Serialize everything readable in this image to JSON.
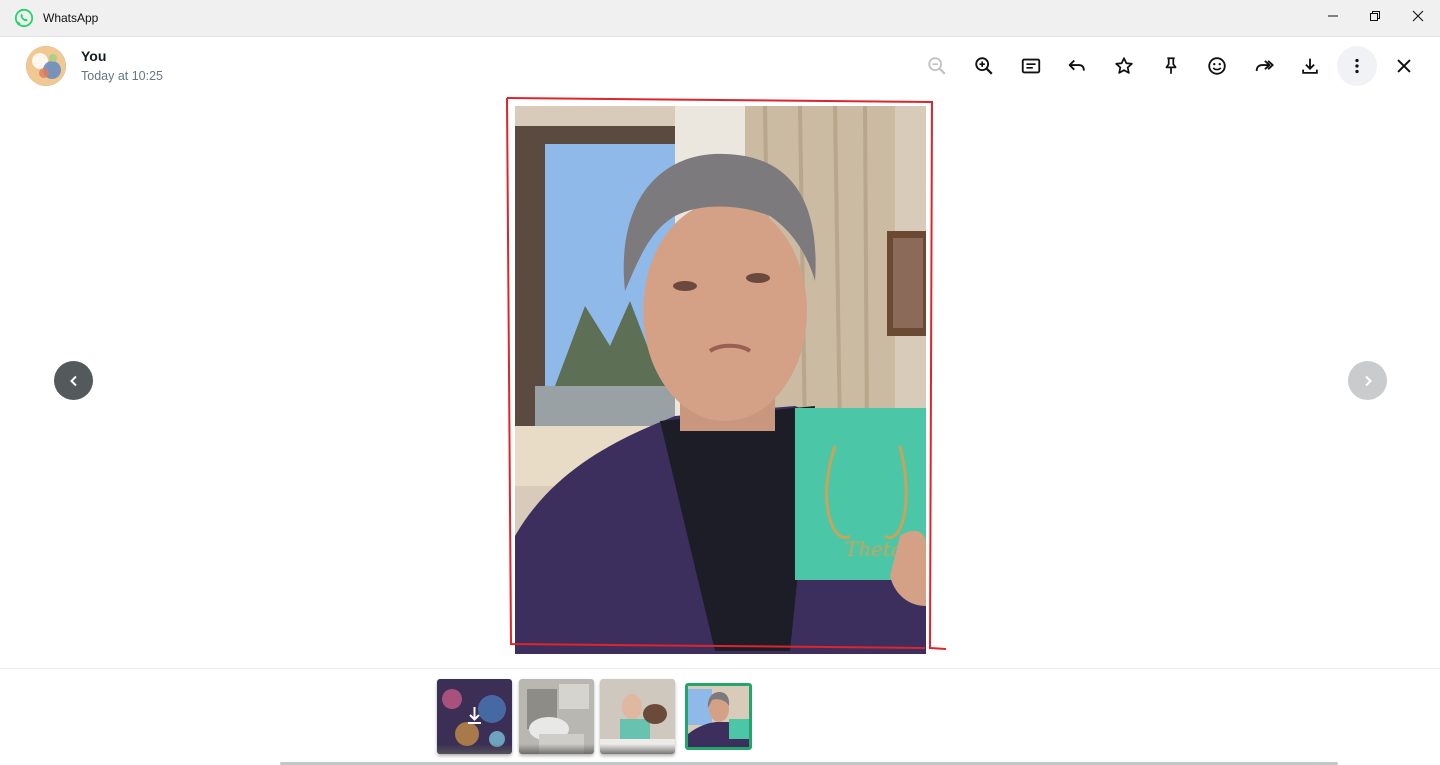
{
  "app": {
    "name": "WhatsApp",
    "brand_color": "#25D366",
    "window_controls": [
      "minimize-icon",
      "restore-icon",
      "close-icon"
    ]
  },
  "header": {
    "sender": "You",
    "timestamp": "Today at 10:25",
    "toolbar": [
      {
        "name": "zoom-out",
        "icon": "zoom-out-icon",
        "enabled": false
      },
      {
        "name": "zoom-in",
        "icon": "zoom-in-icon",
        "enabled": true
      },
      {
        "name": "go-to-message",
        "icon": "message-icon",
        "enabled": true
      },
      {
        "name": "reply",
        "icon": "reply-icon",
        "enabled": true
      },
      {
        "name": "star",
        "icon": "star-icon",
        "enabled": true
      },
      {
        "name": "pin",
        "icon": "pin-icon",
        "enabled": true
      },
      {
        "name": "react",
        "icon": "emoji-icon",
        "enabled": true
      },
      {
        "name": "forward",
        "icon": "forward-icon",
        "enabled": true
      },
      {
        "name": "download",
        "icon": "download-icon",
        "enabled": true
      },
      {
        "name": "more",
        "icon": "more-vertical-icon",
        "enabled": true
      },
      {
        "name": "close",
        "icon": "close-icon",
        "enabled": true
      }
    ]
  },
  "viewer": {
    "annotation_color": "#e0242b",
    "prev_icon": "chevron-left-icon",
    "next_icon": "chevron-right-icon"
  },
  "thumbnails": [
    {
      "label": "media-1",
      "download_icon": true,
      "selected": false
    },
    {
      "label": "media-2",
      "download_icon": false,
      "selected": false
    },
    {
      "label": "media-3",
      "download_icon": false,
      "selected": false
    },
    {
      "label": "media-4",
      "download_icon": false,
      "selected": true
    }
  ],
  "colors": {
    "selected_thumb_border": "#25a46b",
    "secondary_text": "#667781"
  }
}
